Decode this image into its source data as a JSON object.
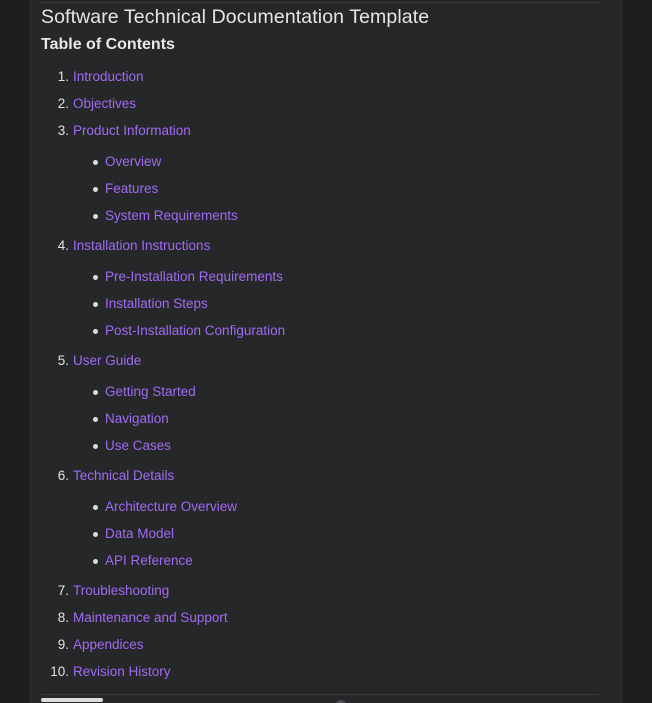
{
  "document": {
    "title": "Software Technical Documentation Template",
    "toc_heading": "Table of Contents"
  },
  "toc": [
    {
      "number": "1.",
      "label": "Introduction",
      "children": []
    },
    {
      "number": "2.",
      "label": "Objectives",
      "children": []
    },
    {
      "number": "3.",
      "label": "Product Information",
      "children": [
        "Overview",
        "Features",
        "System Requirements"
      ]
    },
    {
      "number": "4.",
      "label": "Installation Instructions",
      "children": [
        "Pre-Installation Requirements",
        "Installation Steps",
        "Post-Installation Configuration"
      ]
    },
    {
      "number": "5.",
      "label": "User Guide",
      "children": [
        "Getting Started",
        "Navigation",
        "Use Cases"
      ]
    },
    {
      "number": "6.",
      "label": "Technical Details",
      "children": [
        "Architecture Overview",
        "Data Model",
        "API Reference"
      ]
    },
    {
      "number": "7.",
      "label": "Troubleshooting",
      "children": []
    },
    {
      "number": "8.",
      "label": "Maintenance and Support",
      "children": []
    },
    {
      "number": "9.",
      "label": "Appendices",
      "children": []
    },
    {
      "number": "10.",
      "label": "Revision History",
      "children": []
    }
  ],
  "colors": {
    "link": "#a06bf2",
    "background": "#262729",
    "text": "#e6e6e6"
  }
}
